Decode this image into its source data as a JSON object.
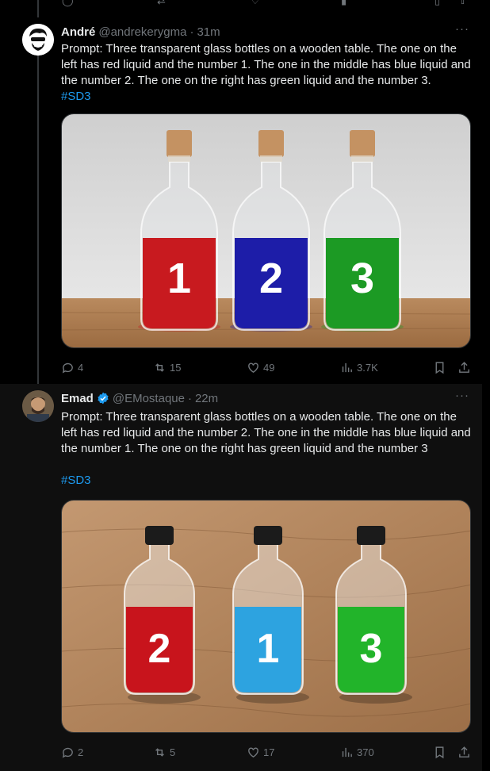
{
  "colors": {
    "accent": "#1d9bf0",
    "muted": "#71767b",
    "text": "#e7e9ea",
    "border": "#2f3336"
  },
  "tweets": [
    {
      "name": "André",
      "handle": "@andrekerygma",
      "dot": "·",
      "time": "31m",
      "more": "···",
      "text": "Prompt: Three transparent glass bottles on a wooden table. The one on the left has red liquid and the number 1. The one in the middle has blue liquid and the number 2. The one on the right has green liquid and the number 3.",
      "hashtag": "#SD3",
      "bottles": [
        {
          "number": "1",
          "color": "#c81a1f"
        },
        {
          "number": "2",
          "color": "#1d1da8"
        },
        {
          "number": "3",
          "color": "#1c9a24"
        }
      ],
      "stats": {
        "replies": "4",
        "reposts": "15",
        "likes": "49",
        "views": "3.7K"
      }
    },
    {
      "name": "Emad",
      "handle": "@EMostaque",
      "dot": "·",
      "time": "22m",
      "more": "···",
      "verified": true,
      "text": "Prompt: Three transparent glass bottles on a wooden table. The one on the left has red liquid and the number 2. The one in the middle has blue liquid and the number 1. The one on the right has green liquid and the number 3",
      "hashtag": "#SD3",
      "bottles": [
        {
          "number": "2",
          "color": "#c8141c"
        },
        {
          "number": "1",
          "color": "#2da3e0"
        },
        {
          "number": "3",
          "color": "#22b42a"
        }
      ],
      "stats": {
        "replies": "2",
        "reposts": "5",
        "likes": "17",
        "views": "370"
      }
    }
  ]
}
